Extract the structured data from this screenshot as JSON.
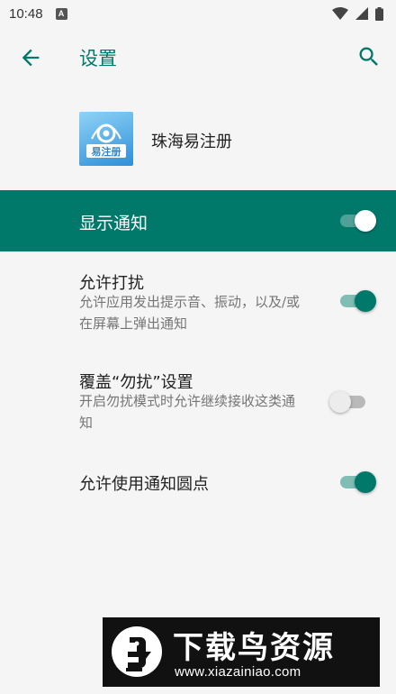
{
  "status_bar": {
    "time": "10:48",
    "notification_icon": "A"
  },
  "app_bar": {
    "title": "设置"
  },
  "app": {
    "name": "珠海易注册",
    "icon_label": "易注册"
  },
  "master_switch": {
    "label": "显示通知",
    "enabled": true
  },
  "settings": [
    {
      "title": "允许打扰",
      "summary": "允许应用发出提示音、振动，以及/或在屏幕上弹出通知",
      "enabled": true
    },
    {
      "title": "覆盖“勿扰”设置",
      "summary": "开启勿扰模式时允许继续接收这类通知",
      "enabled": false
    },
    {
      "title": "允许使用通知圆点",
      "enabled": true
    }
  ],
  "watermark": {
    "title": "下载鸟资源",
    "url": "www.xiazainiao.com"
  },
  "colors": {
    "accent": "#00796b",
    "background": "#f5f5f5"
  }
}
